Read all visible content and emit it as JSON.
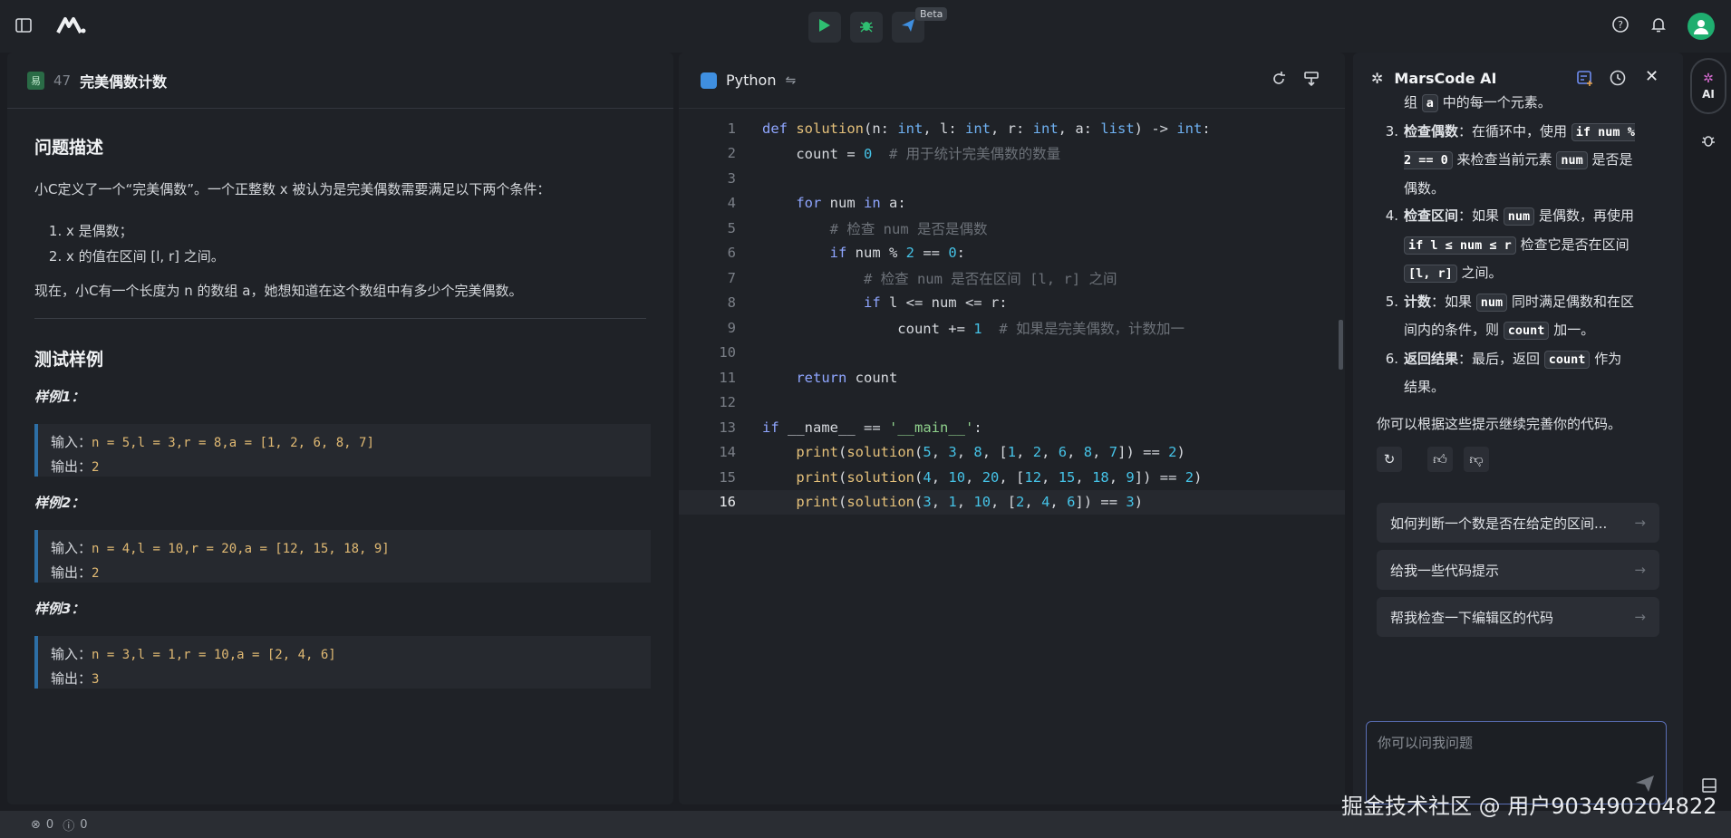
{
  "topbar": {
    "beta": "Beta"
  },
  "problem": {
    "difficulty": "易",
    "number": "47",
    "title": "完美偶数计数",
    "desc_heading": "问题描述",
    "intro": "小C定义了一个“完美偶数”。一个正整数 x 被认为是完美偶数需要满足以下两个条件：",
    "conditions": [
      "x 是偶数；",
      "x 的值在区间 [l, r] 之间。"
    ],
    "question": "现在，小C有一个长度为 n 的数组 a，她想知道在这个数组中有多少个完美偶数。",
    "examples_heading": "测试样例",
    "input_label": "输入：",
    "output_label": "输出：",
    "examples": [
      {
        "title": "样例1：",
        "input": "n = 5,l = 3,r = 8,a = [1, 2, 6, 8, 7]",
        "output": "2"
      },
      {
        "title": "样例2：",
        "input": "n = 4,l = 10,r = 20,a = [12, 15, 18, 9]",
        "output": "2"
      },
      {
        "title": "样例3：",
        "input": "n = 3,l = 1,r = 10,a = [2, 4, 6]",
        "output": "3"
      }
    ]
  },
  "editor": {
    "language": "Python",
    "line_numbers": [
      "1",
      "2",
      "3",
      "4",
      "5",
      "6",
      "7",
      "8",
      "9",
      "10",
      "11",
      "12",
      "13",
      "14",
      "15",
      "16"
    ],
    "active_line": "16"
  },
  "ai": {
    "title": "MarsCode AI",
    "line0": {
      "pre": "组 ",
      "code": "a",
      "post": " 中的每一个元素。"
    },
    "steps": [
      {
        "num": "3.",
        "bold": "检查偶数",
        "text": "：在循环中，使用 ",
        "code1": "if num % 2 == 0",
        "text2": " 来检查当前元素 ",
        "code2": "num",
        "text3": " 是否是偶数。"
      },
      {
        "num": "4.",
        "bold": "检查区间",
        "text": "：如果 ",
        "code1": "num",
        "text2": " 是偶数，再使用 ",
        "code2": "if l ≤ num ≤ r",
        "text3": " 检查它是否在区间 ",
        "code3": "[l, r]",
        "text4": " 之间。"
      },
      {
        "num": "5.",
        "bold": "计数",
        "text": "：如果 ",
        "code1": "num",
        "text2": " 同时满足偶数和在区间内的条件，则 ",
        "code2": "count",
        "text3": " 加一。"
      },
      {
        "num": "6.",
        "bold": "返回结果",
        "text": "：最后，返回 ",
        "code1": "count",
        "text2": " 作为结果。"
      }
    ],
    "closing": "你可以根据这些提示继续完善你的代码。",
    "suggestions": [
      "如何判断一个数是否在给定的区间...",
      "给我一些代码提示",
      "帮我检查一下编辑区的代码"
    ],
    "input_placeholder": "你可以问我问题"
  },
  "rail": {
    "ai_label": "AI"
  },
  "status": {
    "errors": "0",
    "warnings": "0"
  },
  "watermark": "掘金技术社区 @ 用户903490204822"
}
